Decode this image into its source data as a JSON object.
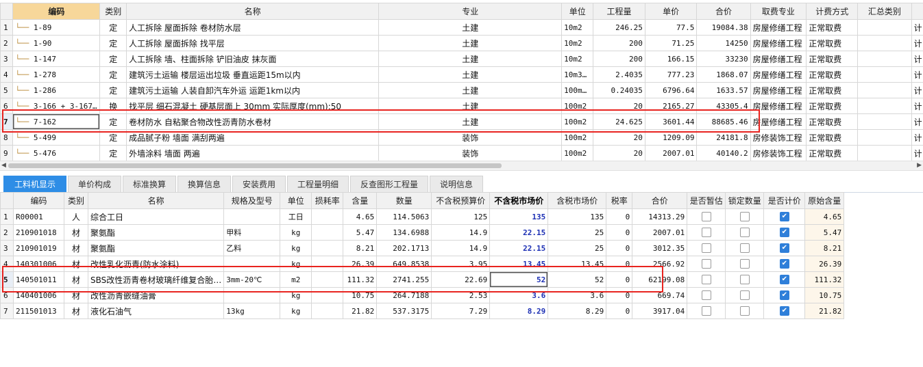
{
  "top_grid": {
    "headers": [
      "编码",
      "类别",
      "名称",
      "专业",
      "单位",
      "工程量",
      "单价",
      "合价",
      "取费专业",
      "计费方式",
      "汇总类别"
    ],
    "rows": [
      {
        "num": "1",
        "code": "1-89",
        "type": "定",
        "name": "人工拆除 屋面拆除 卷材防水层",
        "major": "土建",
        "unit": "10m2",
        "qty": "246.25",
        "price": "77.5",
        "total": "19084.38",
        "fee_major": "房屋修缮工程",
        "fee_method": "正常取费",
        "cut": "计"
      },
      {
        "num": "2",
        "code": "1-90",
        "type": "定",
        "name": "人工拆除 屋面拆除 找平层",
        "major": "土建",
        "unit": "10m2",
        "qty": "200",
        "price": "71.25",
        "total": "14250",
        "fee_major": "房屋修缮工程",
        "fee_method": "正常取费",
        "cut": "计"
      },
      {
        "num": "3",
        "code": "1-147",
        "type": "定",
        "name": "人工拆除 墙、柱面拆除 铲旧油皮 抹灰面",
        "major": "土建",
        "unit": "10m2",
        "qty": "200",
        "price": "166.15",
        "total": "33230",
        "fee_major": "房屋修缮工程",
        "fee_method": "正常取费",
        "cut": "计"
      },
      {
        "num": "4",
        "code": "1-278",
        "type": "定",
        "name": "建筑污土运输 楼层运出垃圾 垂直运距15m以内",
        "major": "土建",
        "unit": "10m3…",
        "qty": "2.4035",
        "price": "777.23",
        "total": "1868.07",
        "fee_major": "房屋修缮工程",
        "fee_method": "正常取费",
        "cut": "计"
      },
      {
        "num": "5",
        "code": "1-286",
        "type": "定",
        "name": "建筑污土运输 人装自卸汽车外运 运距1km以内",
        "major": "土建",
        "unit": "100m…",
        "qty": "0.24035",
        "price": "6796.64",
        "total": "1633.57",
        "fee_major": "房屋修缮工程",
        "fee_method": "正常取费",
        "cut": "计"
      },
      {
        "num": "6",
        "code": "3-166 + 3-167…",
        "type": "换",
        "name": "找平层 细石混凝土 硬基层面上 30mm 实际厚度(mm):50",
        "major": "土建",
        "unit": "100m2",
        "qty": "20",
        "price": "2165.27",
        "total": "43305.4",
        "fee_major": "房屋修缮工程",
        "fee_method": "正常取费",
        "cut": "计"
      },
      {
        "num": "7",
        "code": "7-162",
        "type": "定",
        "name": "卷材防水 自粘聚合物改性沥青防水卷材",
        "major": "土建",
        "unit": "100m2",
        "qty": "24.625",
        "price": "3601.44",
        "total": "88685.46",
        "fee_major": "房屋修缮工程",
        "fee_method": "正常取费",
        "cut": "计"
      },
      {
        "num": "8",
        "code": "5-499",
        "type": "定",
        "name": "成品腻子粉 墙面 满刮两遍",
        "major": "装饰",
        "unit": "100m2",
        "qty": "20",
        "price": "1209.09",
        "total": "24181.8",
        "fee_major": "房修装饰工程",
        "fee_method": "正常取费",
        "cut": "计"
      },
      {
        "num": "9",
        "code": "5-476",
        "type": "定",
        "name": "外墙涂料 墙面 两遍",
        "major": "装饰",
        "unit": "100m2",
        "qty": "20",
        "price": "2007.01",
        "total": "40140.2",
        "fee_major": "房修装饰工程",
        "fee_method": "正常取费",
        "cut": "计"
      }
    ]
  },
  "tabs": [
    "工料机显示",
    "单价构成",
    "标准换算",
    "换算信息",
    "安装费用",
    "工程量明细",
    "反查图形工程量",
    "说明信息"
  ],
  "bottom_grid": {
    "headers": [
      "编码",
      "类别",
      "名称",
      "规格及型号",
      "单位",
      "损耗率",
      "含量",
      "数量",
      "不含税预算价",
      "不含税市场价",
      "含税市场价",
      "税率",
      "合价",
      "是否暂估",
      "锁定数量",
      "是否计价",
      "原始含量"
    ],
    "rows": [
      {
        "num": "1",
        "code": "R00001",
        "type": "人",
        "name": "综合工日",
        "spec": "",
        "unit": "工日",
        "loss": "",
        "content": "4.65",
        "qty": "114.5063",
        "budget": "125",
        "market": "135",
        "market_tax": "135",
        "tax": "0",
        "total": "14313.29",
        "est": false,
        "lock": false,
        "priced": true,
        "orig": "4.65"
      },
      {
        "num": "2",
        "code": "210901018",
        "type": "材",
        "name": "聚氨酯",
        "spec": "甲料",
        "unit": "kg",
        "loss": "",
        "content": "5.47",
        "qty": "134.6988",
        "budget": "14.9",
        "market": "22.15",
        "market_tax": "25",
        "tax": "0",
        "total": "2007.01",
        "est": false,
        "lock": false,
        "priced": true,
        "orig": "5.47"
      },
      {
        "num": "3",
        "code": "210901019",
        "type": "材",
        "name": "聚氨酯",
        "spec": "乙料",
        "unit": "kg",
        "loss": "",
        "content": "8.21",
        "qty": "202.1713",
        "budget": "14.9",
        "market": "22.15",
        "market_tax": "25",
        "tax": "0",
        "total": "3012.35",
        "est": false,
        "lock": false,
        "priced": true,
        "orig": "8.21"
      },
      {
        "num": "4",
        "code": "140301006",
        "type": "材",
        "name": "改性乳化沥青(防水涂料)",
        "spec": "",
        "unit": "kg",
        "loss": "",
        "content": "26.39",
        "qty": "649.8538",
        "budget": "3.95",
        "market": "13.45",
        "market_tax": "13.45",
        "tax": "0",
        "total": "2566.92",
        "est": false,
        "lock": false,
        "priced": true,
        "orig": "26.39"
      },
      {
        "num": "5",
        "code": "140501011",
        "type": "材",
        "name": "SBS改性沥青卷材玻璃纤维复合胎…",
        "spec": "3mm-20℃",
        "unit": "m2",
        "loss": "",
        "content": "111.32",
        "qty": "2741.255",
        "budget": "22.69",
        "market": "52",
        "market_tax": "52",
        "tax": "0",
        "total": "62199.08",
        "est": false,
        "lock": false,
        "priced": true,
        "orig": "111.32"
      },
      {
        "num": "6",
        "code": "140401006",
        "type": "材",
        "name": "改性沥青嵌缝油膏",
        "spec": "",
        "unit": "kg",
        "loss": "",
        "content": "10.75",
        "qty": "264.7188",
        "budget": "2.53",
        "market": "3.6",
        "market_tax": "3.6",
        "tax": "0",
        "total": "669.74",
        "est": false,
        "lock": false,
        "priced": true,
        "orig": "10.75"
      },
      {
        "num": "7",
        "code": "211501013",
        "type": "材",
        "name": "液化石油气",
        "spec": "13kg",
        "unit": "kg",
        "loss": "",
        "content": "21.82",
        "qty": "537.3175",
        "budget": "7.29",
        "market": "8.29",
        "market_tax": "8.29",
        "tax": "0",
        "total": "3917.04",
        "est": false,
        "lock": false,
        "priced": true,
        "orig": "21.82"
      }
    ]
  },
  "icons": {
    "checkbox_checked": "check-icon",
    "tree_line": "tree-branch-icon",
    "scroll_left": "arrow-left-icon",
    "scroll_right": "arrow-right-icon"
  },
  "colors": {
    "active_tab": "#2e8de6",
    "highlight_header": "#f7d79a",
    "market_price_text": "#1c2fb4",
    "annotation_box": "#e8231f"
  }
}
